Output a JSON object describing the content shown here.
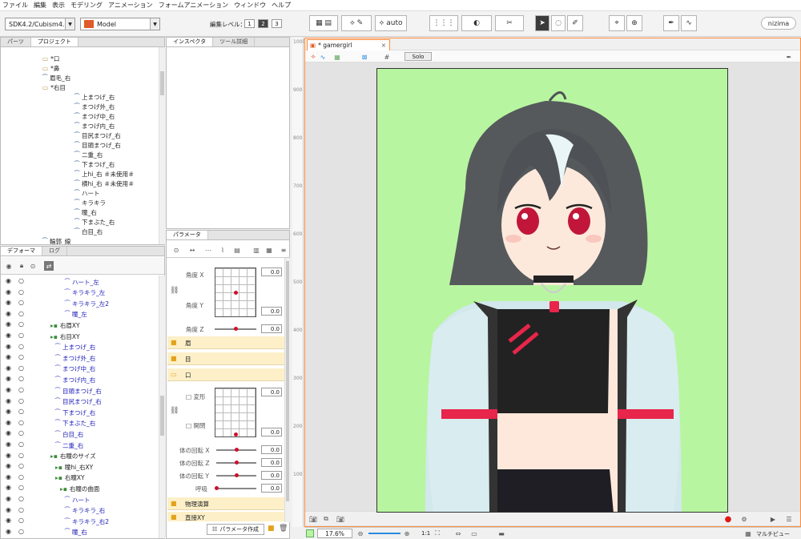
{
  "menu": [
    "ファイル",
    "編集",
    "表示",
    "モデリング",
    "アニメーション",
    "フォームアニメーション",
    "ウィンドウ",
    "ヘルプ"
  ],
  "toolbar": {
    "sdk_select": "SDK4.2/Cubism4.2",
    "mode_select": "Model",
    "edit_level_label": "編集レベル：",
    "levels": [
      "1",
      "2",
      "3"
    ],
    "active_level": "2",
    "brand": "nizima"
  },
  "parts_panel": {
    "tabs": [
      "パーツ",
      "プロジェクト"
    ],
    "active_tab": "プロジェクト",
    "rows": [
      {
        "label": "*口",
        "depth": 3
      },
      {
        "label": "*鼻",
        "depth": 3
      },
      {
        "label": "眉毛_右",
        "depth": 3
      },
      {
        "label": "*右目",
        "depth": 3
      },
      {
        "label": "上まつげ_右",
        "depth": 4
      },
      {
        "label": "まつげ外_右",
        "depth": 4
      },
      {
        "label": "まつげ中_右",
        "depth": 4
      },
      {
        "label": "まつげ内_右",
        "depth": 4
      },
      {
        "label": "目尻まつげ_右",
        "depth": 4
      },
      {
        "label": "目頭まつげ_右",
        "depth": 4
      },
      {
        "label": "二重_右",
        "depth": 4
      },
      {
        "label": "下まつげ_右",
        "depth": 4
      },
      {
        "label": "上hi_右 ＃未使用＃",
        "depth": 4
      },
      {
        "label": "横hi_右 ＃未使用＃",
        "depth": 4
      },
      {
        "label": "ハート",
        "depth": 4
      },
      {
        "label": "キラキラ",
        "depth": 4
      },
      {
        "label": "瞳_右",
        "depth": 4
      },
      {
        "label": "下まぶた_右",
        "depth": 4
      },
      {
        "label": "白目_右",
        "depth": 4
      },
      {
        "label": "輪郭_線",
        "depth": 3
      }
    ]
  },
  "inspector": {
    "tabs": [
      "インスペクタ",
      "ツール詳細"
    ]
  },
  "deformer_panel": {
    "tabs": [
      "デフォーマ",
      "ログ"
    ],
    "rows": [
      {
        "label": "ハート_左",
        "blue": true,
        "depth": 5
      },
      {
        "label": "キラキラ_左",
        "blue": true,
        "depth": 5
      },
      {
        "label": "キラキラ_左2",
        "blue": true,
        "depth": 5
      },
      {
        "label": "瞳_左",
        "blue": true,
        "depth": 5
      },
      {
        "label": "右眉XY",
        "blue": false,
        "depth": 2
      },
      {
        "label": "右目XY",
        "blue": false,
        "depth": 2
      },
      {
        "label": "上まつげ_右",
        "blue": true,
        "depth": 3
      },
      {
        "label": "まつげ外_右",
        "blue": true,
        "depth": 3
      },
      {
        "label": "まつげ中_右",
        "blue": true,
        "depth": 3
      },
      {
        "label": "まつげ内_右",
        "blue": true,
        "depth": 3
      },
      {
        "label": "目頭まつげ_右",
        "blue": true,
        "depth": 3
      },
      {
        "label": "目尻まつげ_右",
        "blue": true,
        "depth": 3
      },
      {
        "label": "下まつげ_右",
        "blue": true,
        "depth": 3
      },
      {
        "label": "下まぶた_右",
        "blue": true,
        "depth": 3
      },
      {
        "label": "白目_右",
        "blue": true,
        "depth": 3
      },
      {
        "label": "二重_右",
        "blue": true,
        "depth": 3
      },
      {
        "label": "右瞳のサイズ",
        "blue": false,
        "depth": 2
      },
      {
        "label": "瞳hi_右XY",
        "blue": false,
        "depth": 3
      },
      {
        "label": "右瞳XY",
        "blue": false,
        "depth": 3
      },
      {
        "label": "右瞳の曲面",
        "blue": false,
        "depth": 4
      },
      {
        "label": "ハート",
        "blue": true,
        "depth": 5
      },
      {
        "label": "キラキラ_右",
        "blue": true,
        "depth": 5
      },
      {
        "label": "キラキラ_右2",
        "blue": true,
        "depth": 5
      },
      {
        "label": "瞳_右",
        "blue": true,
        "depth": 5
      }
    ]
  },
  "parameters": {
    "tab": "パラメータ",
    "create_button": "パラメータ作成",
    "angle_x": "角度 X",
    "angle_y": "角度 Y",
    "angle_z": "角度 Z",
    "folder_brow": "眉",
    "folder_eye": "目",
    "folder_mouth": "口",
    "mouth_form": "変形",
    "mouth_open": "開閉",
    "body_x": "体の回転 X",
    "body_y": "体の回転 Y",
    "body_z": "体の回転 Z",
    "breath": "呼吸",
    "folder_physics": "物理演算",
    "folder_last": "直接XY",
    "values": {
      "grid1": "0.0",
      "grid1b": "0.0",
      "z": "0.0",
      "mouth1": "0.0",
      "mouth2": "0.0",
      "bx": "0.0",
      "by": "0.0",
      "bz": "0.0",
      "breath": "0.0"
    }
  },
  "viewport": {
    "tab_title": "* gamergirl",
    "solo_label": "Solo",
    "ruler_marks": [
      "1000",
      "900",
      "800",
      "700",
      "600",
      "500",
      "400",
      "300",
      "200",
      "100"
    ]
  },
  "status": {
    "zoom": "17.6%",
    "scale": "1:1",
    "multiview": "マルチビュー"
  },
  "colors": {
    "accent": "#ff8c3a",
    "canvas_bg": "#b8f5a0",
    "record": "#e01818"
  }
}
